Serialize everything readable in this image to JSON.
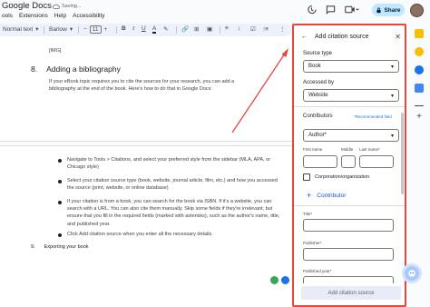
{
  "header": {
    "title": "Google Docs",
    "saving": "Saving...",
    "menu": [
      "ools",
      "Extensions",
      "Help",
      "Accessibility"
    ],
    "share_label": "Share"
  },
  "toolbar": {
    "style": "Normal text",
    "font": "Barlow",
    "font_size": "11"
  },
  "document": {
    "img_placeholder": "[IMG]",
    "section8_num": "8.",
    "section8_title": "Adding a bibliography",
    "section8_body": "If your eBook topic requires you to cite the sources for your research, you can add a bibliography at the end of the book. Here's how to do that in Google Docs:",
    "bullets": [
      "Navigate to Tools > Citations, and select your preferred style from the sidebar (MLA, APA, or Chicago style)",
      "Select your citation source type (book, website, journal article, film, etc.) and how you accessed the source (print, website, or online database)",
      "If your citation is from a book, you can search for the book via ISBN. If it's a website, you can search with a URL. You can also cite them manually. Skip some fields if they're irrelevant, but ensure that you fill in the required fields (marked with asterisks), such as the author's name, title, and published year.",
      "Click Add citation source when you enter all the necessary details."
    ],
    "section9_num": "9.",
    "section9_title": "Exporting your book"
  },
  "citation_panel": {
    "title": "Add citation source",
    "source_type_label": "Source type",
    "source_type_value": "Book",
    "accessed_by_label": "Accessed by",
    "accessed_by_value": "Website",
    "contributors_label": "Contributors",
    "recommended_label": "*Recommended field",
    "role_value": "Author*",
    "first_name_label": "First name",
    "middle_label": "Middle",
    "last_name_label": "Last name*",
    "corporation_label": "Corporation/organization",
    "add_contributor_label": "Contributor",
    "title_label": "Title*",
    "publisher_label": "Publisher*",
    "published_year_label": "Published year*",
    "submit_label": "Add citation source"
  },
  "colors": {
    "highlight": "#e8453c",
    "accent": "#0b57d0",
    "share_bg": "#c2e7ff"
  }
}
